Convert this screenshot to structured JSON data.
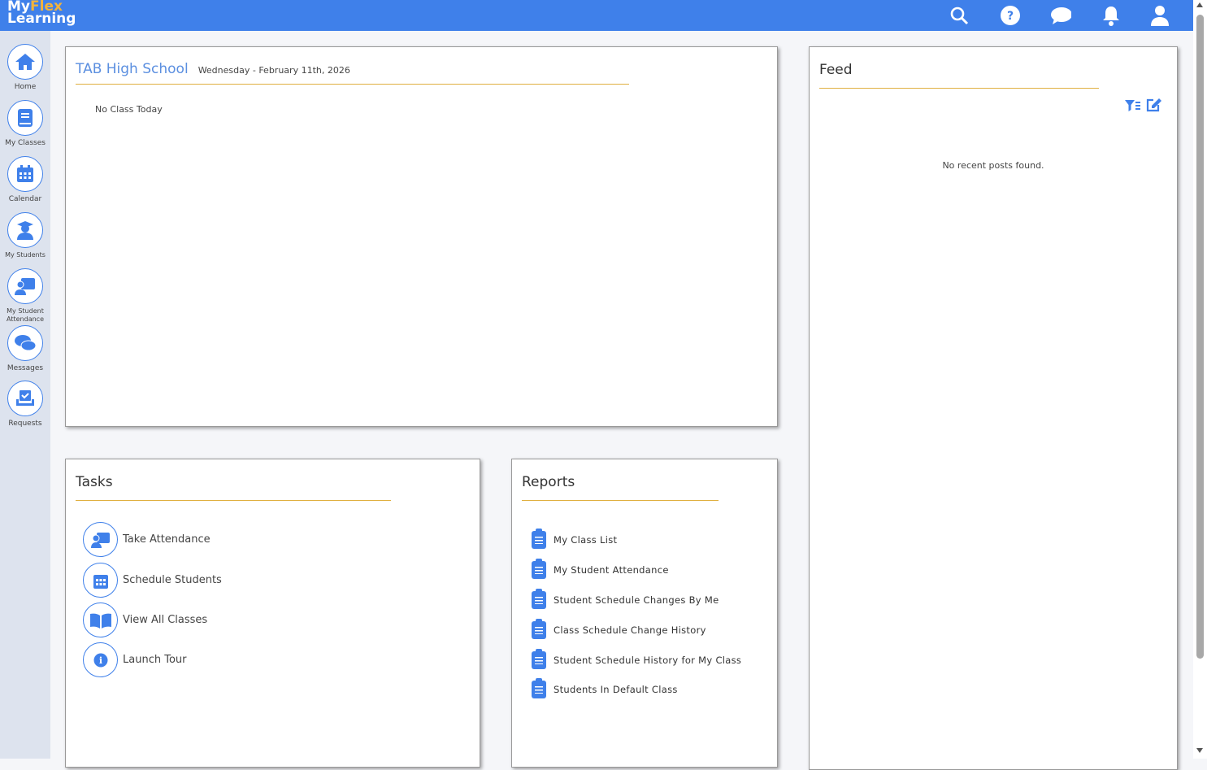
{
  "header": {
    "logo_my": "My",
    "logo_flex": "Flex",
    "logo_learning": "Learning",
    "icons": [
      "search-icon",
      "help-icon",
      "chat-icon",
      "bell-icon",
      "user-icon"
    ]
  },
  "sidebar": {
    "items": [
      {
        "label": "Home",
        "icon": "home-icon"
      },
      {
        "label": "My Classes",
        "icon": "book-icon"
      },
      {
        "label": "Calendar",
        "icon": "calendar-icon"
      },
      {
        "label": "My Students",
        "icon": "graduate-icon"
      },
      {
        "label": "My Student Attendance",
        "icon": "teacher-board-icon"
      },
      {
        "label": "Messages",
        "icon": "comments-icon"
      },
      {
        "label": "Requests",
        "icon": "inbox-check-icon"
      }
    ]
  },
  "school": {
    "title": "TAB High School",
    "date": "Wednesday - February 11th, 2026",
    "empty": "No Class Today"
  },
  "tasks": {
    "title": "Tasks",
    "items": [
      {
        "label": "Take Attendance",
        "icon": "teacher-board-icon"
      },
      {
        "label": "Schedule Students",
        "icon": "calendar-icon"
      },
      {
        "label": "View All Classes",
        "icon": "open-book-icon"
      },
      {
        "label": "Launch Tour",
        "icon": "info-icon"
      }
    ]
  },
  "reports": {
    "title": "Reports",
    "items": [
      "My Class List",
      "My Student Attendance",
      "Student Schedule Changes By Me",
      "Class Schedule Change History",
      "Student Schedule History for My Class",
      "Students In Default Class"
    ]
  },
  "feed": {
    "title": "Feed",
    "empty": "No recent posts found."
  },
  "colors": {
    "brand": "#3f80ea",
    "accent": "#e0b040"
  }
}
